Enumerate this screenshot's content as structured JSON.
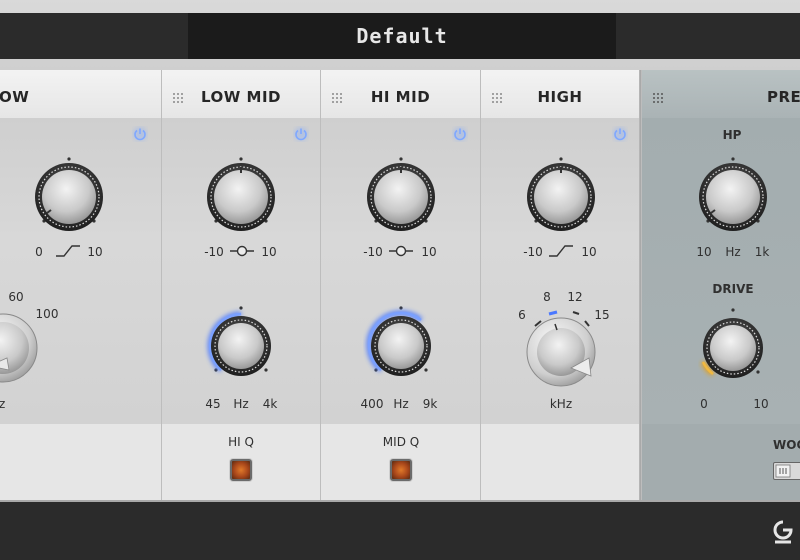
{
  "preset": {
    "name": "Default"
  },
  "bands": [
    {
      "title": "OW",
      "scale_min": "0",
      "scale_max": "10",
      "freq_ticks": [
        "60",
        "100"
      ],
      "freq_unit": "z"
    },
    {
      "title": "LOW MID",
      "gain_min": "-10",
      "gain_max": "10",
      "freq_min": "45",
      "freq_unit": "Hz",
      "freq_max": "4k",
      "toggle_label": "HI Q"
    },
    {
      "title": "HI MID",
      "gain_min": "-10",
      "gain_max": "10",
      "freq_min": "400",
      "freq_unit": "Hz",
      "freq_max": "9k",
      "toggle_label": "MID Q"
    },
    {
      "title": "HIGH",
      "gain_min": "-10",
      "gain_max": "10",
      "freq_ticks": [
        "6",
        "8",
        "12",
        "15"
      ],
      "freq_unit": "kHz"
    }
  ],
  "preamp": {
    "title": "PREA",
    "hp_label": "HP",
    "hp_min": "10",
    "hp_unit": "Hz",
    "hp_max": "1k",
    "drive_label": "DRIVE",
    "drive_min": "0",
    "drive_max": "10",
    "woo_label": "WOO"
  },
  "colors": {
    "power_blue": "#7fa8ff",
    "ring_blue": "#4a78ff",
    "drive_amber": "#e0a020",
    "led_orange": "#d06a20"
  }
}
